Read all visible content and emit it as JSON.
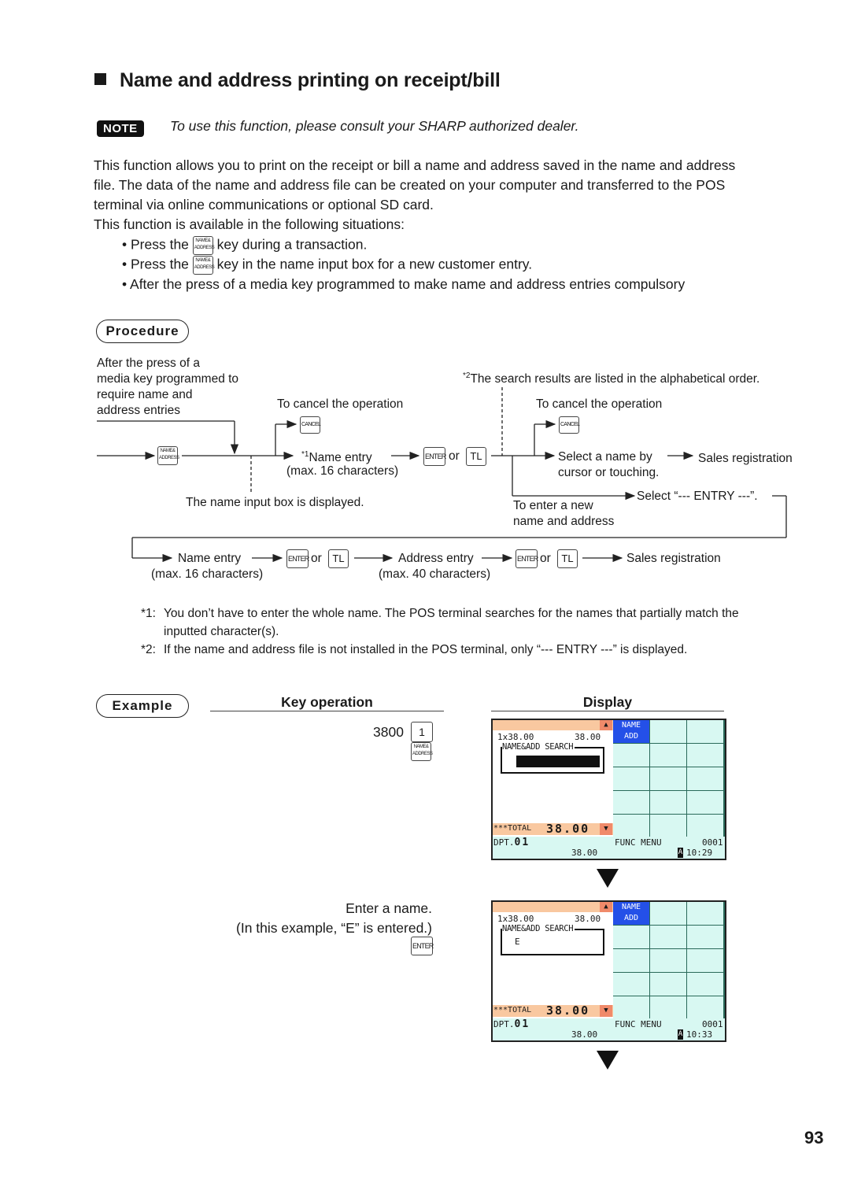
{
  "heading": "Name and address printing on receipt/bill",
  "note": {
    "badge": "NOTE",
    "text": "To use this function, please consult your SHARP authorized dealer."
  },
  "intro": {
    "lines": [
      "This function allows you to print on the receipt or bill a name and address saved in the name and address",
      "file. The data of the name and address file can be created on your computer and transferred to the POS",
      "terminal via online communications or optional SD card.",
      "This function is available in the following situations:"
    ],
    "bullets": [
      {
        "prefix": "• Press the",
        "key": "NAME& ADDRESS",
        "suffix": "key during a transaction."
      },
      {
        "prefix": "• Press the",
        "key": "NAME& ADDRESS",
        "suffix": "key in the name input box for a new customer entry."
      },
      {
        "prefix": "• After the press of a media key programmed to make name and address entries compulsory",
        "key": "",
        "suffix": ""
      }
    ]
  },
  "procedure": {
    "label": "Procedure",
    "media_key_note": [
      "After the press of a",
      "media key programmed to",
      "require name and",
      "address entries"
    ],
    "cancel_note_1": "To cancel the operation",
    "cancel_note_2": "To cancel the operation",
    "search_note_mark": "*2",
    "search_note": "The search results are listed in the alphabetical order.",
    "name_entry_mark": "*1",
    "name_entry": "Name entry",
    "name_entry_max": "(max. 16 characters)",
    "or": "or",
    "input_box_note": "The name input box is displayed.",
    "select_name": [
      "Select a name by",
      "cursor or touching."
    ],
    "sales_registration": "Sales registration",
    "select_entry": "Select “--- ENTRY ---”.",
    "new_entry_note": [
      "To enter a new",
      "name and address"
    ],
    "row2": {
      "name_entry": "Name entry",
      "name_entry_max": "(max. 16 characters)",
      "address_entry": "Address entry",
      "address_entry_max": "(max. 40 characters)",
      "sales_registration": "Sales registration"
    },
    "keys": {
      "name_address": [
        "NAME&",
        "ADDRESS"
      ],
      "cancel": "CANCEL",
      "enter": "ENTER",
      "tl": "TL"
    }
  },
  "footnotes": [
    {
      "mark": "*1:",
      "lines": [
        "You don’t have to enter the whole name. The POS terminal searches for the names that partially match the",
        "inputted character(s)."
      ]
    },
    {
      "mark": "*2:",
      "lines": [
        "If the name and address file is not installed in the POS terminal, only “--- ENTRY ---” is displayed."
      ]
    }
  ],
  "example": {
    "label": "Example",
    "key_operation_header": "Key operation",
    "display_header": "Display",
    "steps": [
      {
        "amount": "3800",
        "key1": "1",
        "key2": [
          "NAME&",
          "ADDRESS"
        ]
      },
      {
        "lines": [
          "Enter a name.",
          "(In this example, “E” is entered.)"
        ],
        "key": "ENTER"
      }
    ],
    "screens": [
      {
        "item_qty_price": "1x38.00",
        "item_amount": "38.00",
        "search_label": "NAME&ADD SEARCH",
        "search_value": "",
        "button": [
          "NAME",
          "ADD"
        ],
        "total_label": "***TOTAL",
        "total_value": "38.00",
        "dept": "DPT.",
        "dept_num": "01",
        "subtotal": "38.00",
        "func_menu": "FUNC MENU",
        "counter": "0001",
        "mode": "A",
        "time": "10:29"
      },
      {
        "item_qty_price": "1x38.00",
        "item_amount": "38.00",
        "search_label": "NAME&ADD SEARCH",
        "search_value": "E",
        "button": [
          "NAME",
          "ADD"
        ],
        "total_label": "***TOTAL",
        "total_value": "38.00",
        "dept": "DPT.",
        "dept_num": "01",
        "subtotal": "38.00",
        "func_menu": "FUNC MENU",
        "counter": "0001",
        "mode": "A",
        "time": "10:33"
      }
    ]
  },
  "page_number": "93",
  "colors": {
    "lcd_header": "#f9c8a0",
    "lcd_arrow": "#f08a6a",
    "lcd_button": "#2450e8",
    "lcd_cell": "#d8f8f2",
    "lcd_grid": "#2a6a5a"
  }
}
